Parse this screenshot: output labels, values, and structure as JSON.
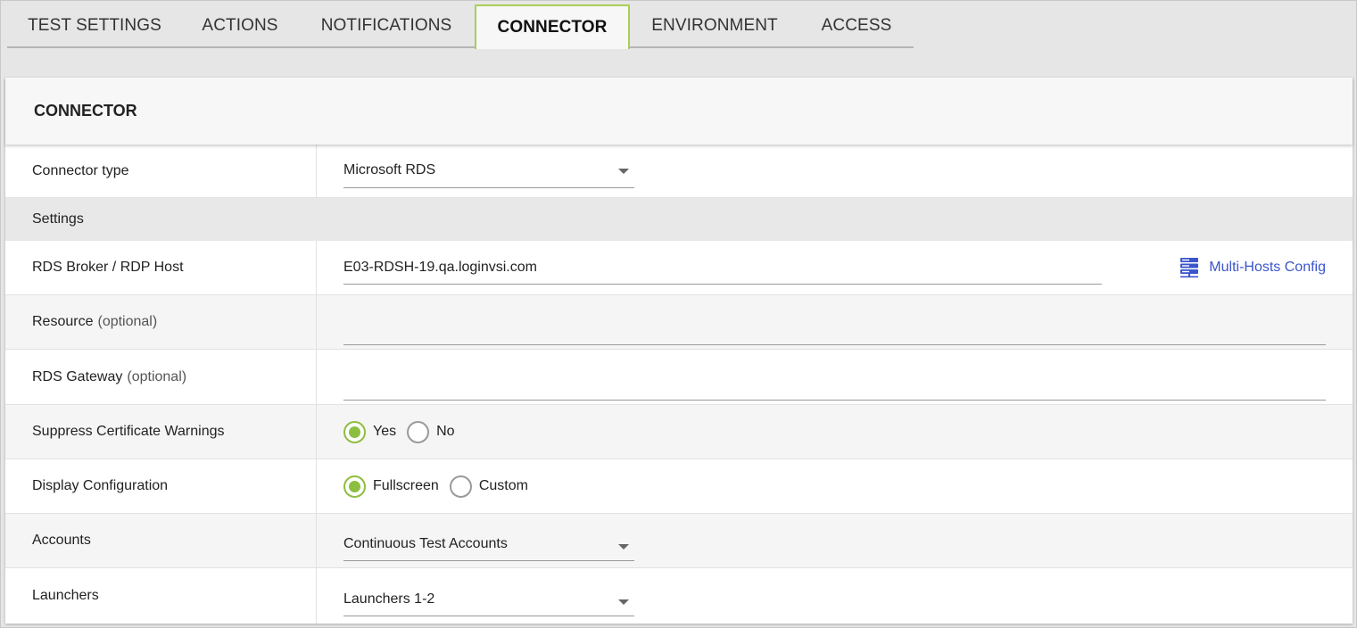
{
  "tabs": [
    {
      "label": "TEST SETTINGS"
    },
    {
      "label": "ACTIONS"
    },
    {
      "label": "NOTIFICATIONS"
    },
    {
      "label": "CONNECTOR",
      "active": true
    },
    {
      "label": "ENVIRONMENT"
    },
    {
      "label": "ACCESS"
    }
  ],
  "panel": {
    "title": "CONNECTOR",
    "connector_type": {
      "label": "Connector type",
      "value": "Microsoft RDS"
    },
    "settings_section": "Settings",
    "rds_broker": {
      "label": "RDS Broker / RDP Host",
      "value": "E03-RDSH-19.qa.loginvsi.com",
      "link_label": "Multi-Hosts Config",
      "link_icon": "server-stack-icon"
    },
    "resource": {
      "label": "Resource",
      "optional": "(optional)",
      "value": ""
    },
    "rds_gateway": {
      "label": "RDS Gateway",
      "optional": "(optional)",
      "value": ""
    },
    "suppress_cert": {
      "label": "Suppress Certificate Warnings",
      "options": [
        "Yes",
        "No"
      ],
      "selected": "Yes"
    },
    "display_config": {
      "label": "Display Configuration",
      "options": [
        "Fullscreen",
        "Custom"
      ],
      "selected": "Fullscreen"
    },
    "accounts": {
      "label": "Accounts",
      "value": "Continuous Test Accounts"
    },
    "launchers": {
      "label": "Launchers",
      "value": "Launchers 1-2"
    }
  },
  "colors": {
    "accent_green": "#8dbf3f",
    "tab_active_border": "#a9cf54",
    "link_blue": "#3b55cc",
    "page_bg": "#e6e6e6"
  }
}
